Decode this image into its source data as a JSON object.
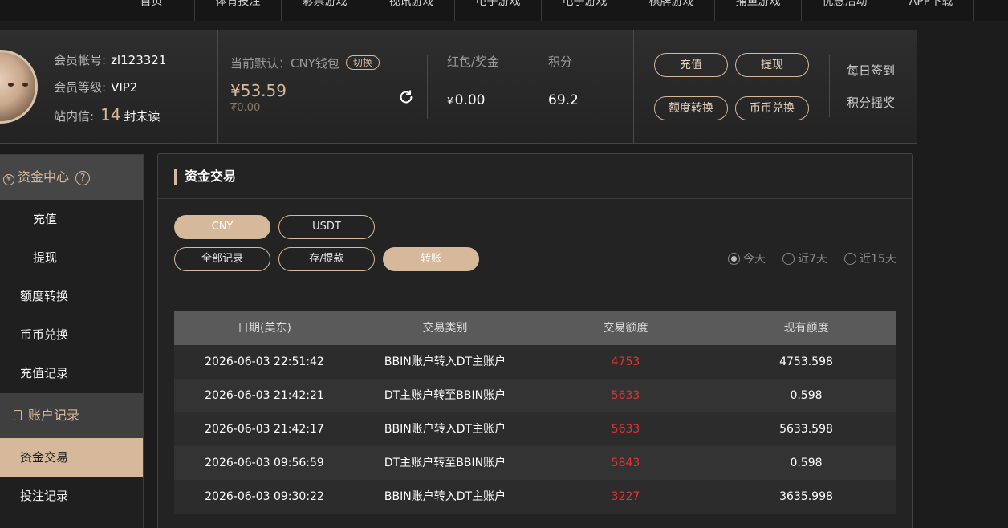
{
  "nav": [
    "首页",
    "体育投注",
    "彩票游戏",
    "视讯游戏",
    "电子游戏",
    "电子游戏",
    "棋牌游戏",
    "捕鱼游戏",
    "优惠活动",
    "APP下载"
  ],
  "member": {
    "account_label": "会员帐号:",
    "account": "zl123321",
    "level_label": "会员等级:",
    "level": "VIP2",
    "inbox_label": "站内信:",
    "unread_count": "14",
    "unread_text": "封未读"
  },
  "wallet": {
    "label": "当前默认：CNY钱包",
    "switch_label": "切换",
    "amount": "¥53.59",
    "sub_amount": "₮0.00"
  },
  "bonus": {
    "label": "红包/奖金",
    "currency": "¥",
    "value": "0.00"
  },
  "points": {
    "label": "积分",
    "value": "69.2"
  },
  "actions": {
    "deposit": "充值",
    "withdraw": "提现",
    "quota_transfer": "额度转换",
    "coin_exchange": "币币兑换",
    "daily_checkin": "每日签到",
    "points_shake": "积分摇奖"
  },
  "sidebar": {
    "section1": "资金中心",
    "section1_items": [
      "充值",
      "提现",
      "额度转换",
      "币币兑换",
      "充值记录"
    ],
    "section2": "账户记录",
    "section2_items": [
      "资金交易",
      "投注记录"
    ]
  },
  "main": {
    "title": "资金交易",
    "currency_tabs": [
      "CNY",
      "USDT"
    ],
    "filter_tabs": [
      "全部记录",
      "存/提款",
      "转账"
    ],
    "date_options": [
      "今天",
      "近7天",
      "近15天"
    ],
    "columns": [
      "日期(美东)",
      "交易类别",
      "交易额度",
      "现有额度"
    ],
    "rows": [
      {
        "date": "2026-06-03 22:51:42",
        "type": "BBIN账户转入DT主账户",
        "amount": "4753",
        "balance": "4753.598"
      },
      {
        "date": "2026-06-03 21:42:21",
        "type": "DT主账户转至BBIN账户",
        "amount": "5633",
        "balance": "0.598"
      },
      {
        "date": "2026-06-03 21:42:17",
        "type": "BBIN账户转入DT主账户",
        "amount": "5633",
        "balance": "5633.598"
      },
      {
        "date": "2026-06-03 09:56:59",
        "type": "DT主账户转至BBIN账户",
        "amount": "5843",
        "balance": "0.598"
      },
      {
        "date": "2026-06-03 09:30:22",
        "type": "BBIN账户转入DT主账户",
        "amount": "3227",
        "balance": "3635.998"
      }
    ]
  },
  "colors": {
    "accent": "#d6b89b",
    "negative": "#e53333",
    "background": "#1c1c1c"
  }
}
